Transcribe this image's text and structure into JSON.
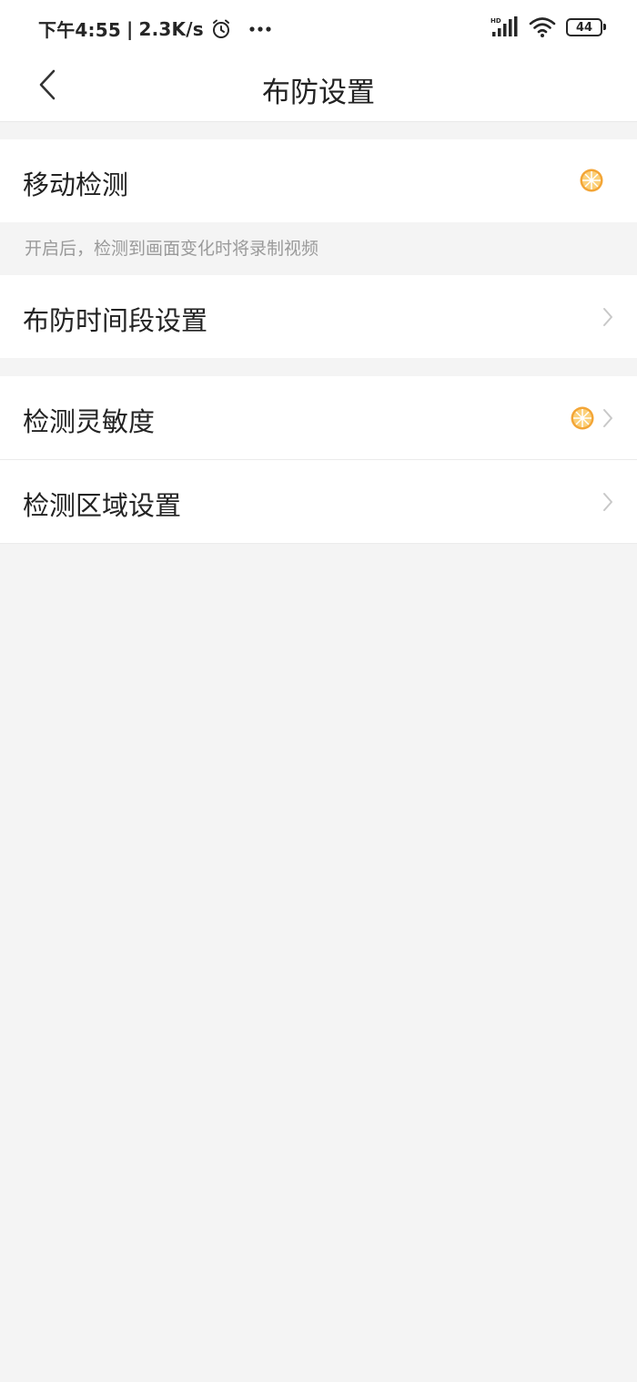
{
  "status_bar": {
    "time": "下午4:55",
    "separator": "|",
    "net_speed": "2.3K/s",
    "alarm_icon": "alarm-clock-icon",
    "more_icon": "more-dots-icon",
    "signal_icon": "hd-signal-icon",
    "signal_label": "HD",
    "wifi_icon": "wifi-icon",
    "battery_level": "44"
  },
  "nav": {
    "back_icon": "chevron-left-icon",
    "title": "布防设置"
  },
  "settings": {
    "motion_detection": {
      "label": "移动检测",
      "status_icon": "orange-slice-icon",
      "hint": "开启后，检测到画面变化时将录制视频"
    },
    "arming_schedule": {
      "label": "布防时间段设置",
      "icon": "chevron-right-icon"
    },
    "sensitivity": {
      "label": "检测灵敏度",
      "status_icon": "orange-slice-icon",
      "icon": "chevron-right-icon"
    },
    "detection_area": {
      "label": "检测区域设置",
      "icon": "chevron-right-icon"
    }
  },
  "colors": {
    "accent_orange": "#f3a536",
    "background": "#f4f4f4",
    "card": "#ffffff",
    "chevron": "#c8c8c8",
    "hint_text": "#9a9a9a"
  }
}
